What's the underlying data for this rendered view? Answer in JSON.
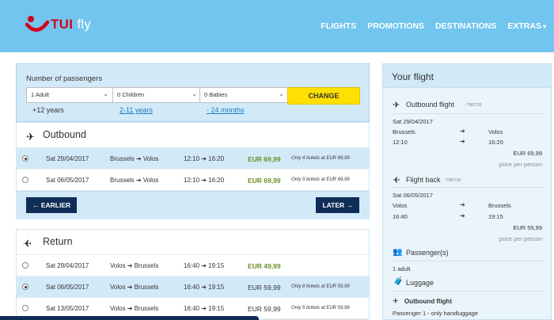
{
  "header": {
    "brand": "TUI",
    "brand_suffix": "fly",
    "nav": [
      "FLIGHTS",
      "PROMOTIONS",
      "DESTINATIONS",
      "EXTRAS"
    ]
  },
  "passengers": {
    "title": "Number of passengers",
    "adults": "1 Adult",
    "children": "0 Children",
    "babies": "0 Babies",
    "adults_sub": "+12 years",
    "children_sub": "2-11 years",
    "babies_sub": "- 24 months",
    "change_label": "CHANGE"
  },
  "outbound": {
    "title": "Outbound",
    "rows": [
      {
        "date": "Sat 29/04/2017",
        "route": "Brussels ➔ Volos",
        "time": "12:10 ➔ 16:20",
        "price": "EUR 69,99",
        "note": "Only 4 tickets at EUR 69,99",
        "selected": true,
        "green": true
      },
      {
        "date": "Sat 06/05/2017",
        "route": "Brussels ➔ Volos",
        "time": "12:10 ➔ 16:20",
        "price": "EUR 69,99",
        "note": "Only 5 tickets at EUR 69,99",
        "selected": false,
        "green": true
      }
    ],
    "earlier_label": "← EARLIER",
    "later_label": "LATER →"
  },
  "return": {
    "title": "Return",
    "rows": [
      {
        "date": "Sat 29/04/2017",
        "route": "Volos ➔ Brussels",
        "time": "16:40 ➔ 19:15",
        "price": "EUR 49,99",
        "note": "",
        "selected": false,
        "green": true
      },
      {
        "date": "Sat 06/05/2017",
        "route": "Volos ➔ Brussels",
        "time": "16:40 ➔ 19:15",
        "price": "EUR 59,99",
        "note": "Only 8 tickets at EUR 59,99",
        "selected": true,
        "green": false
      },
      {
        "date": "Sat 13/05/2017",
        "route": "Volos ➔ Brussels",
        "time": "16:40 ➔ 19:15",
        "price": "EUR 59,99",
        "note": "Only 5 tickets at EUR 59,99",
        "selected": false,
        "green": false
      }
    ]
  },
  "summary": {
    "title": "Your flight",
    "outbound_label": "Outbound flight",
    "outbound_code": "- TB6735",
    "outbound_date": "Sat 29/04/2017",
    "outbound_from": "Brussels",
    "outbound_to": "Volos",
    "outbound_dep": "12:10",
    "outbound_arr": "16:20",
    "outbound_price": "EUR 69,99",
    "price_per_person": "price per person",
    "back_label": "Flight back",
    "back_code": "- TB6736",
    "back_date": "Sat 06/05/2017",
    "back_from": "Volos",
    "back_to": "Brussels",
    "back_dep": "16:40",
    "back_arr": "19:15",
    "back_price": "EUR 59,99",
    "passengers_label": "Passenger(s)",
    "passengers_value": "1 adult",
    "luggage_label": "Luggage",
    "luggage_outbound": "Outbound flight",
    "luggage_detail": "Passenger 1 - only handluggage"
  }
}
